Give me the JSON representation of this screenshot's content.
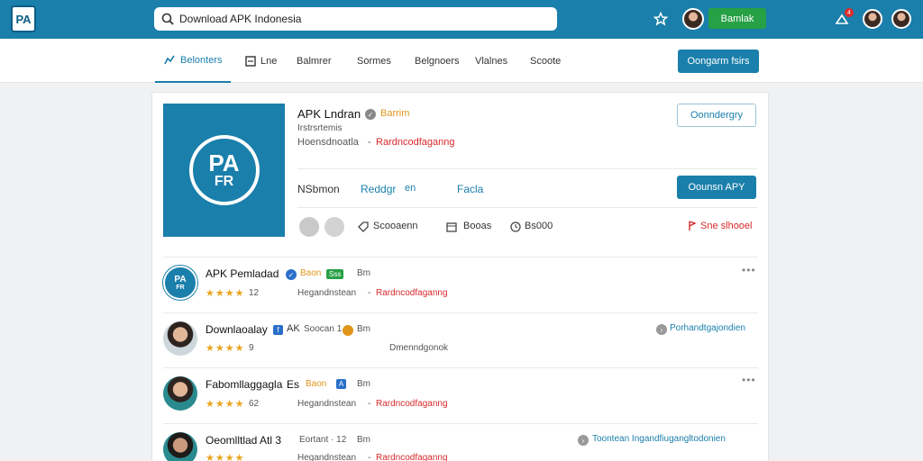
{
  "header": {
    "logo_text": "PA",
    "search_value": "Download APK Indonesia",
    "green_button": "Bamlak",
    "notification_count": "4"
  },
  "nav": {
    "tabs": [
      "Belonters",
      "Lne",
      "Balmrer",
      "Sormes",
      "Belgnoers",
      "Vlalnes",
      "Scoote"
    ],
    "primary_button": "Oongarm fsirs"
  },
  "app": {
    "hero_top": "PA",
    "hero_bottom": "FR",
    "title": "APK Lndran",
    "badge": "Barrim",
    "subtitle": "Irstrsrtemis",
    "meta_gray": "Hoensdnoatla",
    "meta_red": "Rardncodfaganng",
    "outline_button": "Oonndergry",
    "info_label": "NSbmon",
    "info_mid": "Reddgr",
    "info_mid2": "en",
    "info_right": "Facla",
    "download_button": "Oounsn APY",
    "stat1": "Scooaenn",
    "stat2": "Booas",
    "stat3": "Bs000",
    "report_link": "Sne slhooel"
  },
  "list": [
    {
      "title": "APK Pemladad",
      "tag": "Baon",
      "green_tag": "Sss",
      "size": "Bm",
      "rating": "12",
      "desc_gray": "Hegandnstean",
      "desc_red": "Rardncodfaganng"
    },
    {
      "title": "Downlaoalay",
      "pre": "AK",
      "mid": "Soocan 1 1",
      "size": "Bm",
      "rating": "9",
      "desc_center": "Dmenndgonok",
      "right_link": "Porhandtgajondien"
    },
    {
      "title": "Fabomllaggagla",
      "title_suffix": "Es",
      "tag": "Baon",
      "size": "Bm",
      "rating": "62",
      "desc_gray": "Hegandnstean",
      "desc_red": "Rardncodfaganng"
    },
    {
      "title": "Oeomlltlad Atl 3",
      "mid": "Eortant · 12",
      "size": "Bm",
      "rating": "",
      "desc_gray": "Hegandnstean",
      "desc_red": "Rardncodfaganng",
      "right_link": "Toontean Ingandfiugangltodonien"
    }
  ]
}
